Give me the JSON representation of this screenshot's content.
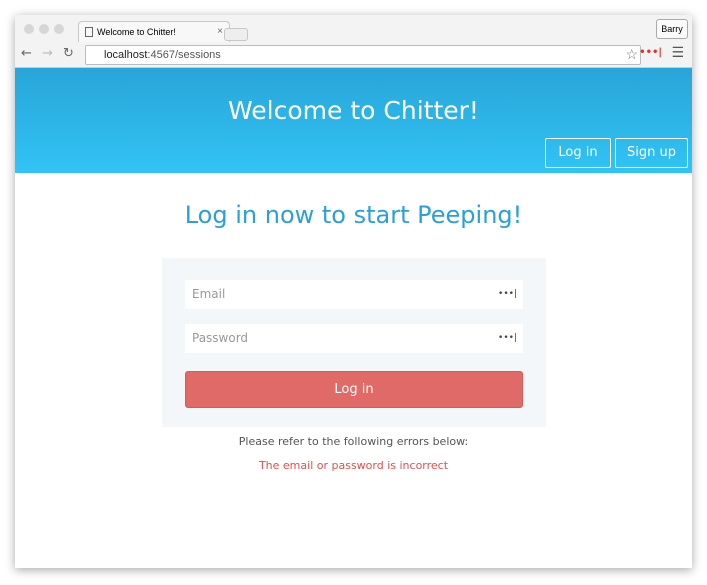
{
  "browser": {
    "tab_title": "Welcome to Chitter!",
    "profile": "Barry",
    "url_host": "localhost",
    "url_rest": ":4567/sessions"
  },
  "header": {
    "title": "Welcome to Chitter!",
    "login_label": "Log in",
    "signup_label": "Sign up"
  },
  "main": {
    "heading": "Log in now to start Peeping!",
    "email_placeholder": "Email",
    "password_placeholder": "Password",
    "submit_label": "Log in",
    "errors_intro": "Please refer to the following errors below:",
    "error": "The email or password is incorrect"
  },
  "colors": {
    "header": "#2cb4e8",
    "heading": "#2b9fd8",
    "button": "#e06a67",
    "error": "#e0504d"
  }
}
